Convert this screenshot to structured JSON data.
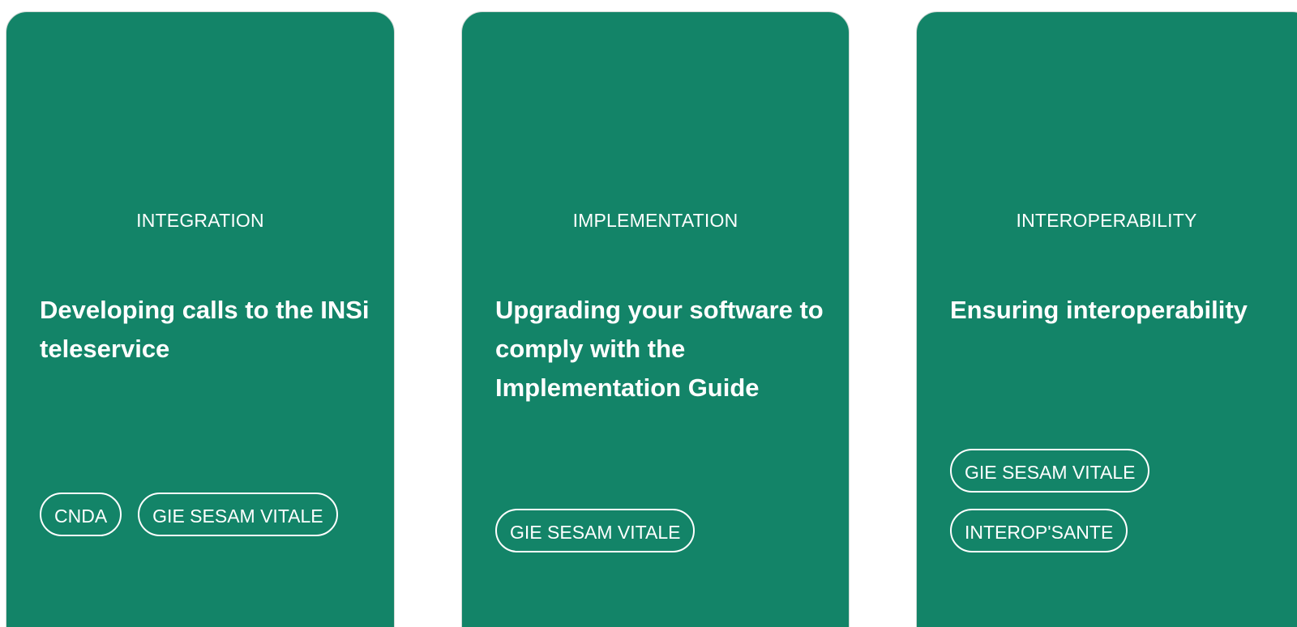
{
  "colors": {
    "card_background": "#138468",
    "text": "#ffffff"
  },
  "cards": [
    {
      "category": "INTEGRATION",
      "title": "Developing calls to the INSi teleservice",
      "tags": [
        "CNDA",
        "GIE SESAM VITALE"
      ]
    },
    {
      "category": "IMPLEMENTATION",
      "title": "Upgrading your software to comply with the Implementation Guide",
      "tags": [
        "GIE SESAM VITALE"
      ]
    },
    {
      "category": "INTEROPERABILITY",
      "title": "Ensuring interoperability",
      "tags": [
        "GIE SESAM VITALE",
        "INTEROP'SANTE"
      ]
    }
  ]
}
